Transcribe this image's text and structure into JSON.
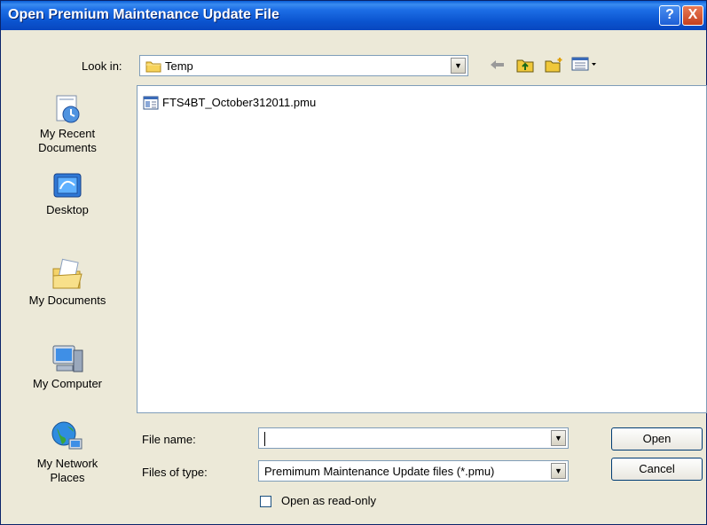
{
  "window": {
    "title": "Open Premium Maintenance Update File",
    "help_label": "?",
    "close_label": "X"
  },
  "lookin": {
    "label": "Look in:",
    "value": "Temp"
  },
  "places": [
    {
      "label": "My Recent Documents",
      "icon": "recent-documents-icon"
    },
    {
      "label": "Desktop",
      "icon": "desktop-icon"
    },
    {
      "label": "My Documents",
      "icon": "my-documents-icon"
    },
    {
      "label": "My Computer",
      "icon": "my-computer-icon"
    },
    {
      "label": "My Network Places",
      "icon": "network-places-icon"
    }
  ],
  "files": [
    {
      "name": "FTS4BT_October312011.pmu",
      "icon": "pmu-file-icon"
    }
  ],
  "filename": {
    "label": "File name:",
    "value": ""
  },
  "filetype": {
    "label": "Files of type:",
    "value": "Premimum Maintenance Update files (*.pmu)"
  },
  "readonly": {
    "label": "Open as read-only",
    "checked": false
  },
  "buttons": {
    "open": "Open",
    "cancel": "Cancel"
  },
  "colors": {
    "titlebar": "#0b54cf",
    "dialog_bg": "#ece9d8",
    "field_border": "#7f9db9"
  }
}
